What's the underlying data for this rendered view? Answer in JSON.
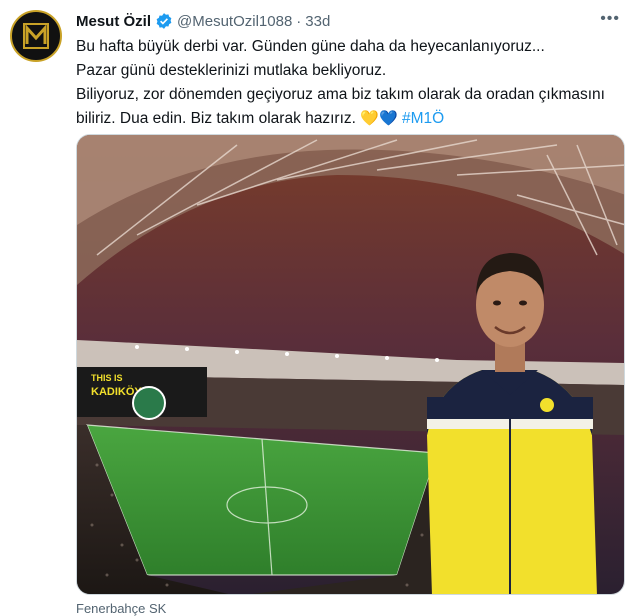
{
  "tweet": {
    "author_name": "Mesut Özil",
    "handle": "@MesutOzil1088",
    "separator": "·",
    "time": "33d",
    "more_icon": "more-horizontal-icon",
    "verified_icon": "verified-badge-icon",
    "lines": [
      "Bu hafta büyük derbi var. Günden güne daha da heyecanlanıyoruz...",
      "Pazar günü desteklerinizi mutlaka bekliyoruz.",
      "Biliyoruz, zor dönemden geçiyoruz ama biz takım olarak da oradan çıkmasını",
      "biliriz. Dua edin. Biz takım olarak hazırız."
    ],
    "emoji_yellow_heart": "💛",
    "emoji_blue_heart": "💙",
    "hashtag": "#M1Ö",
    "source": "Fenerbahçe SK",
    "stadium_banner_1": "THIS IS",
    "stadium_banner_2": "KADIKÖY"
  },
  "colors": {
    "link": "#1d9bf0",
    "verified": "#1d9bf0",
    "jacket_yellow": "#f2e02c",
    "jacket_navy": "#1b2340",
    "pitch_green": "#3f9a3a"
  }
}
